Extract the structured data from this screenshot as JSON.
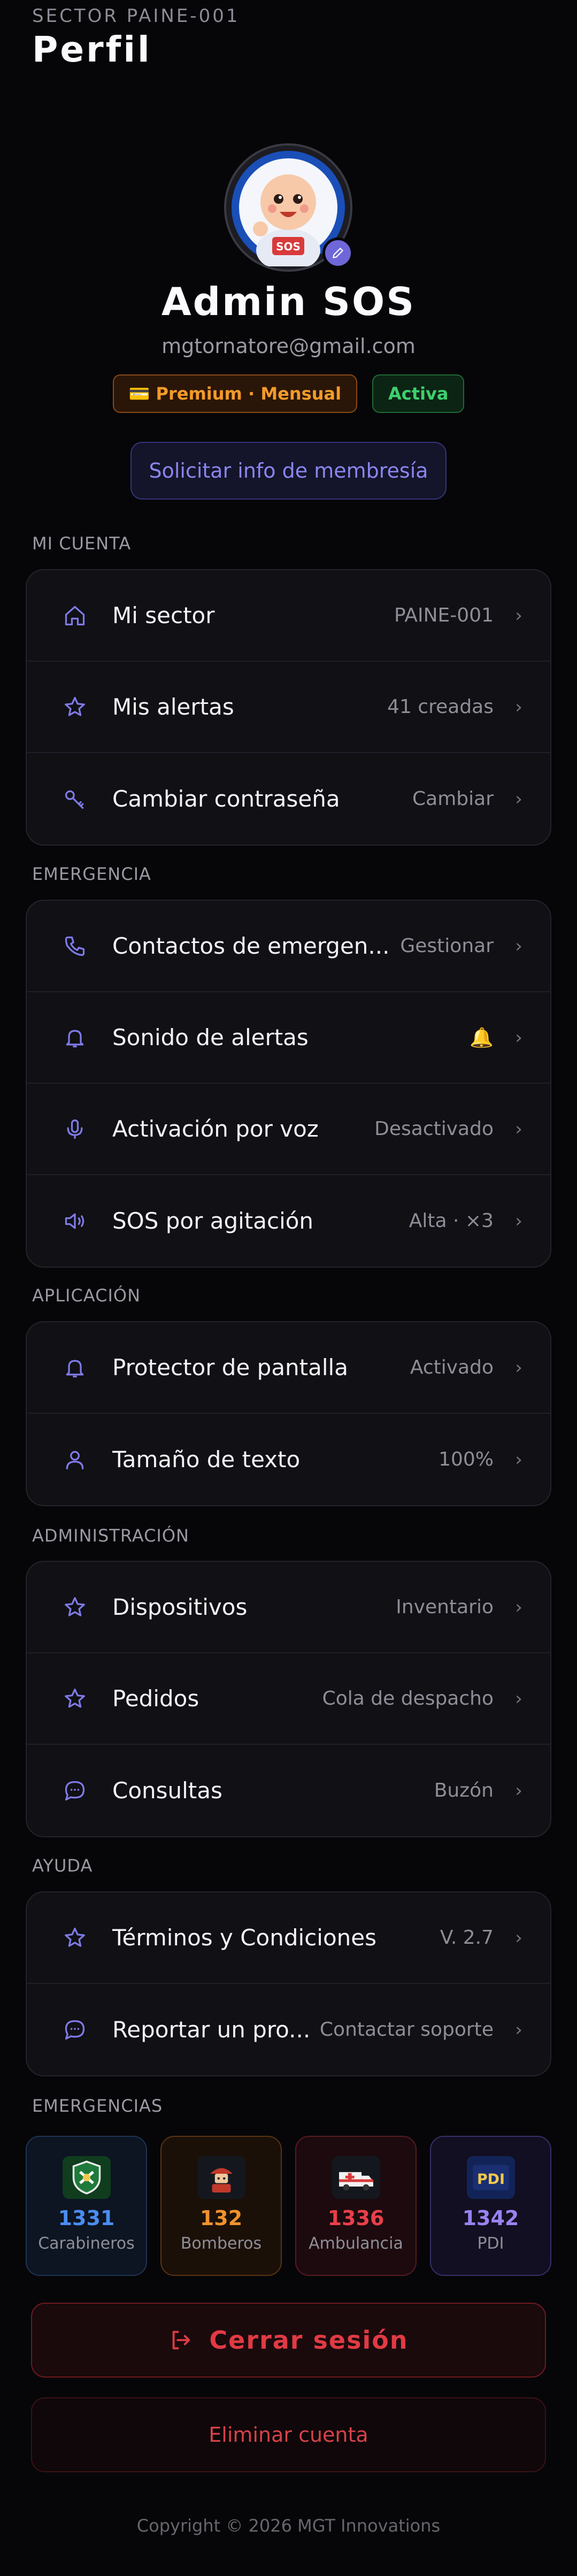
{
  "header": {
    "sector_code": "SECTOR PAINE-001",
    "title": "Perfil"
  },
  "profile": {
    "name": "Admin SOS",
    "email": "mgtornatore@gmail.com",
    "plan_badge": "💳 Premium · Mensual",
    "status_badge": "Activa",
    "membership_button": "Solicitar info de membresía"
  },
  "sections": {
    "account": {
      "label": "MI CUENTA",
      "items": [
        {
          "label": "Mi sector",
          "value": "PAINE-001",
          "icon": "home-icon"
        },
        {
          "label": "Mis alertas",
          "value": "41 creadas",
          "icon": "star-icon"
        },
        {
          "label": "Cambiar contraseña",
          "value": "Cambiar",
          "icon": "key-icon"
        }
      ]
    },
    "emergency": {
      "label": "EMERGENCIA",
      "items": [
        {
          "label": "Contactos de emergen...",
          "value": "Gestionar",
          "icon": "phone-icon"
        },
        {
          "label": "Sonido de alertas",
          "value": "🔔",
          "icon": "bell-icon"
        },
        {
          "label": "Activación por voz",
          "value": "Desactivado",
          "icon": "microphone-icon"
        },
        {
          "label": "SOS por agitación",
          "value": "Alta · ×3",
          "icon": "speaker-icon"
        }
      ]
    },
    "app": {
      "label": "APLICACIÓN",
      "items": [
        {
          "label": "Protector de pantalla",
          "value": "Activado",
          "icon": "bell-icon"
        },
        {
          "label": "Tamaño de texto",
          "value": "100%",
          "icon": "user-icon"
        }
      ]
    },
    "admin": {
      "label": "ADMINISTRACIÓN",
      "items": [
        {
          "label": "Dispositivos",
          "value": "Inventario",
          "icon": "star-icon"
        },
        {
          "label": "Pedidos",
          "value": "Cola de despacho",
          "icon": "star-icon"
        },
        {
          "label": "Consultas",
          "value": "Buzón",
          "icon": "chat-icon"
        }
      ]
    },
    "help": {
      "label": "AYUDA",
      "items": [
        {
          "label": "Términos y Condiciones",
          "value": "V. 2.7",
          "icon": "star-icon"
        },
        {
          "label": "Reportar un pro...",
          "value": "Contactar soporte",
          "icon": "chat-icon"
        }
      ]
    }
  },
  "emergencies": {
    "label": "EMERGENCIAS",
    "services": [
      {
        "number": "1331",
        "name": "Carabineros",
        "color": "#4a8ef0",
        "bg": "#0d1422",
        "border": "#1f3454"
      },
      {
        "number": "132",
        "name": "Bomberos",
        "color": "#f0922e",
        "bg": "#1b1008",
        "border": "#5a3414"
      },
      {
        "number": "1336",
        "name": "Ambulancia",
        "color": "#e8404a",
        "bg": "#1c0a0e",
        "border": "#5a1a22"
      },
      {
        "number": "1342",
        "name": "PDI",
        "color": "#9a82f0",
        "bg": "#120f22",
        "border": "#36306a"
      }
    ]
  },
  "actions": {
    "logout": "Cerrar sesión",
    "delete": "Eliminar cuenta"
  },
  "footer": {
    "copyright": "Copyright © 2026 MGT Innovations"
  },
  "colors": {
    "accent": "#6f67d8",
    "icon": "#7f7ae6"
  }
}
